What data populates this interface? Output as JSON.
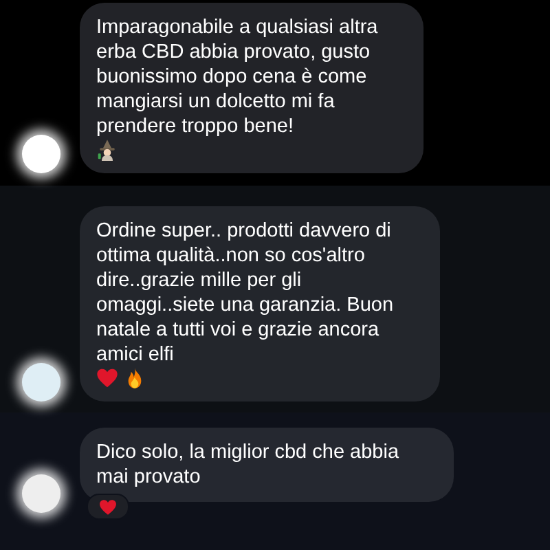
{
  "messages": [
    {
      "text": "Imparagonabile a qualsiasi altra erba CBD abbia provato, gusto buonissimo dopo cena è come mangiarsi un dolcetto mi fa prendere troppo bene!",
      "emojis": [
        {
          "kind": "witch"
        }
      ]
    },
    {
      "text": "Ordine super.. prodotti davvero di ottima qualità..non so cos'altro dire..grazie mille per gli omaggi..siete una garanzia. Buon natale a tutti voi e grazie ancora amici elfi",
      "emojis": [
        {
          "kind": "heart"
        },
        {
          "kind": "fire"
        }
      ]
    },
    {
      "text": "Dico solo, la miglior cbd che abbia mai provato",
      "reaction": {
        "kind": "heart"
      }
    }
  ]
}
